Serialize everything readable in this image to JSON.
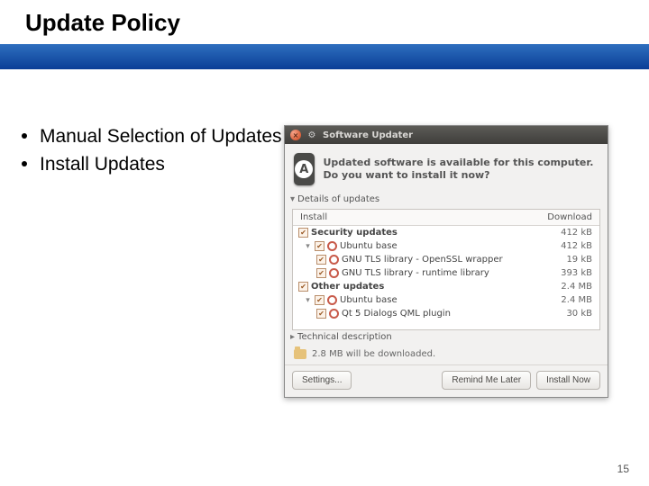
{
  "slide": {
    "title": "Update Policy",
    "page_number": "15"
  },
  "bullets": [
    "Manual Selection of Updates",
    "Install Updates"
  ],
  "updater": {
    "window_title": "Software Updater",
    "heading": "Updated software is available for this computer. Do you want to install it now?",
    "details_label": "Details of updates",
    "technical_label": "Technical description",
    "columns": {
      "install": "Install",
      "download": "Download"
    },
    "groups": [
      {
        "name": "Security updates",
        "size": "412 kB",
        "checked": true,
        "items": [
          {
            "name": "Ubuntu base",
            "size": "412 kB",
            "checked": true,
            "children": [
              {
                "name": "GNU TLS library - OpenSSL wrapper",
                "size": "19 kB",
                "checked": true
              },
              {
                "name": "GNU TLS library - runtime library",
                "size": "393 kB",
                "checked": true
              }
            ]
          }
        ]
      },
      {
        "name": "Other updates",
        "size": "2.4 MB",
        "checked": true,
        "items": [
          {
            "name": "Ubuntu base",
            "size": "2.4 MB",
            "checked": true,
            "children": [
              {
                "name": "Qt 5 Dialogs QML plugin",
                "size": "30 kB",
                "checked": true
              }
            ]
          }
        ]
      }
    ],
    "download_summary": "2.8 MB will be downloaded.",
    "buttons": {
      "settings": "Settings...",
      "remind": "Remind Me Later",
      "install": "Install Now"
    }
  }
}
